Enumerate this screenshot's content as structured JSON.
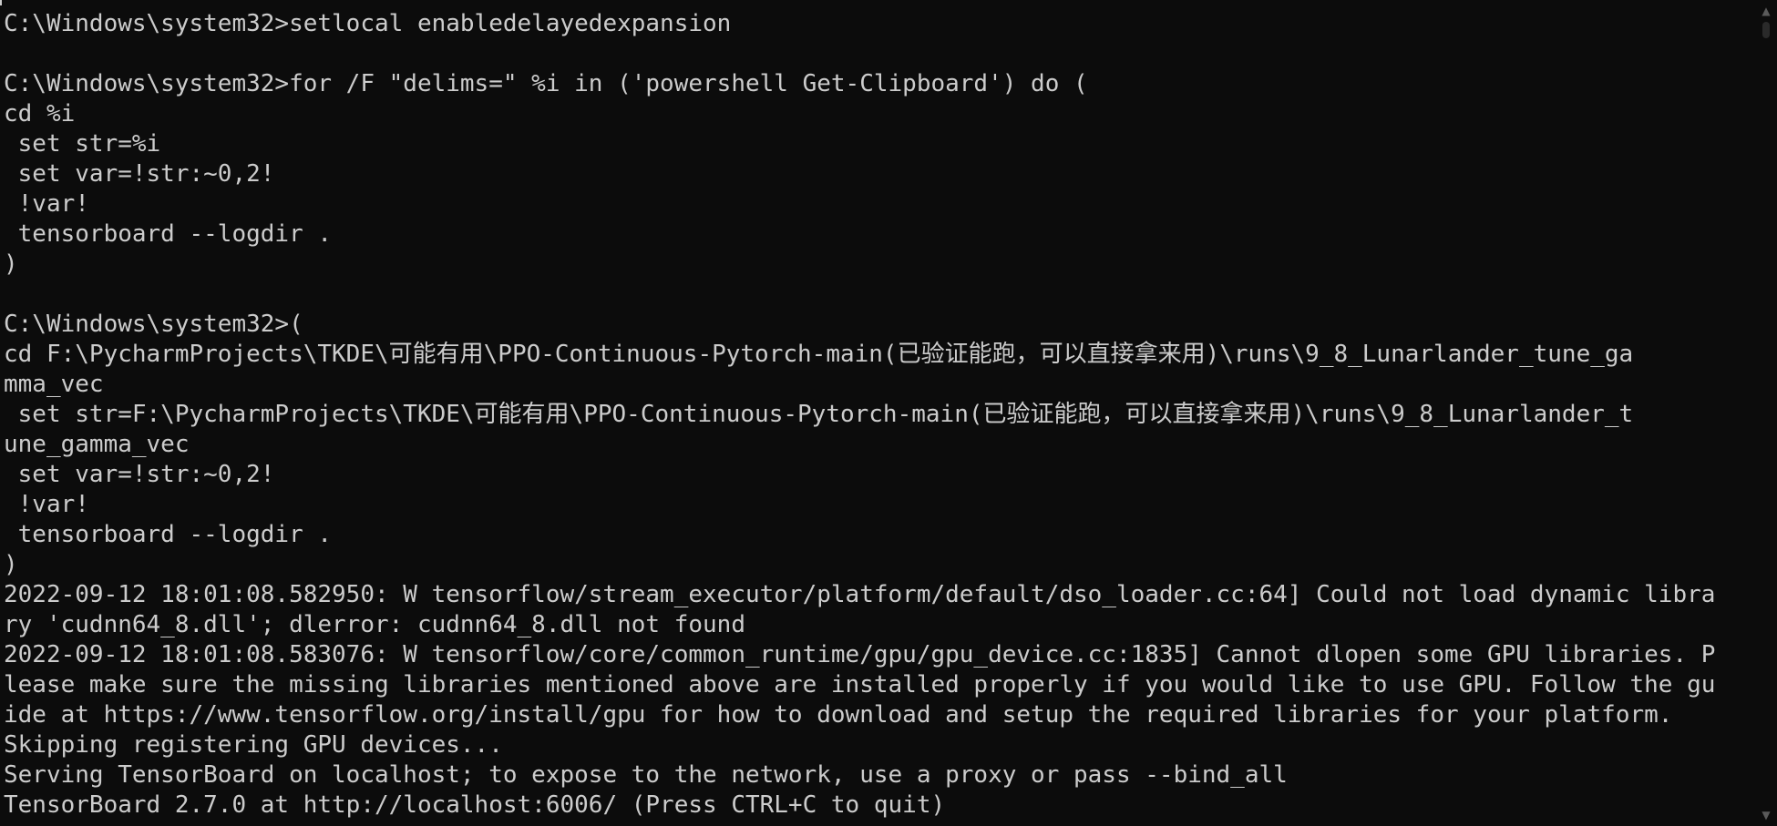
{
  "console": {
    "background": "#0c0c0c",
    "foreground": "#cccccc",
    "lines": [
      "C:\\Windows\\system32>setlocal enabledelayedexpansion",
      "",
      "C:\\Windows\\system32>for /F \"delims=\" %i in ('powershell Get-Clipboard') do (",
      "cd %i",
      " set str=%i",
      " set var=!str:~0,2!",
      " !var!",
      " tensorboard --logdir .",
      ")",
      "",
      "C:\\Windows\\system32>(",
      "cd F:\\PycharmProjects\\TKDE\\可能有用\\PPO-Continuous-Pytorch-main(已验证能跑，可以直接拿来用)\\runs\\9_8_Lunarlander_tune_ga",
      "mma_vec",
      " set str=F:\\PycharmProjects\\TKDE\\可能有用\\PPO-Continuous-Pytorch-main(已验证能跑，可以直接拿来用)\\runs\\9_8_Lunarlander_t",
      "une_gamma_vec",
      " set var=!str:~0,2!",
      " !var!",
      " tensorboard --logdir .",
      ")",
      "2022-09-12 18:01:08.582950: W tensorflow/stream_executor/platform/default/dso_loader.cc:64] Could not load dynamic libra",
      "ry 'cudnn64_8.dll'; dlerror: cudnn64_8.dll not found",
      "2022-09-12 18:01:08.583076: W tensorflow/core/common_runtime/gpu/gpu_device.cc:1835] Cannot dlopen some GPU libraries. P",
      "lease make sure the missing libraries mentioned above are installed properly if you would like to use GPU. Follow the gu",
      "ide at https://www.tensorflow.org/install/gpu for how to download and setup the required libraries for your platform.",
      "Skipping registering GPU devices...",
      "Serving TensorBoard on localhost; to expose to the network, use a proxy or pass --bind_all",
      "TensorBoard 2.7.0 at http://localhost:6006/ (Press CTRL+C to quit)"
    ]
  },
  "scrollbar": {
    "up_icon": "scroll-up-arrow-icon",
    "down_icon": "scroll-down-arrow-icon"
  }
}
